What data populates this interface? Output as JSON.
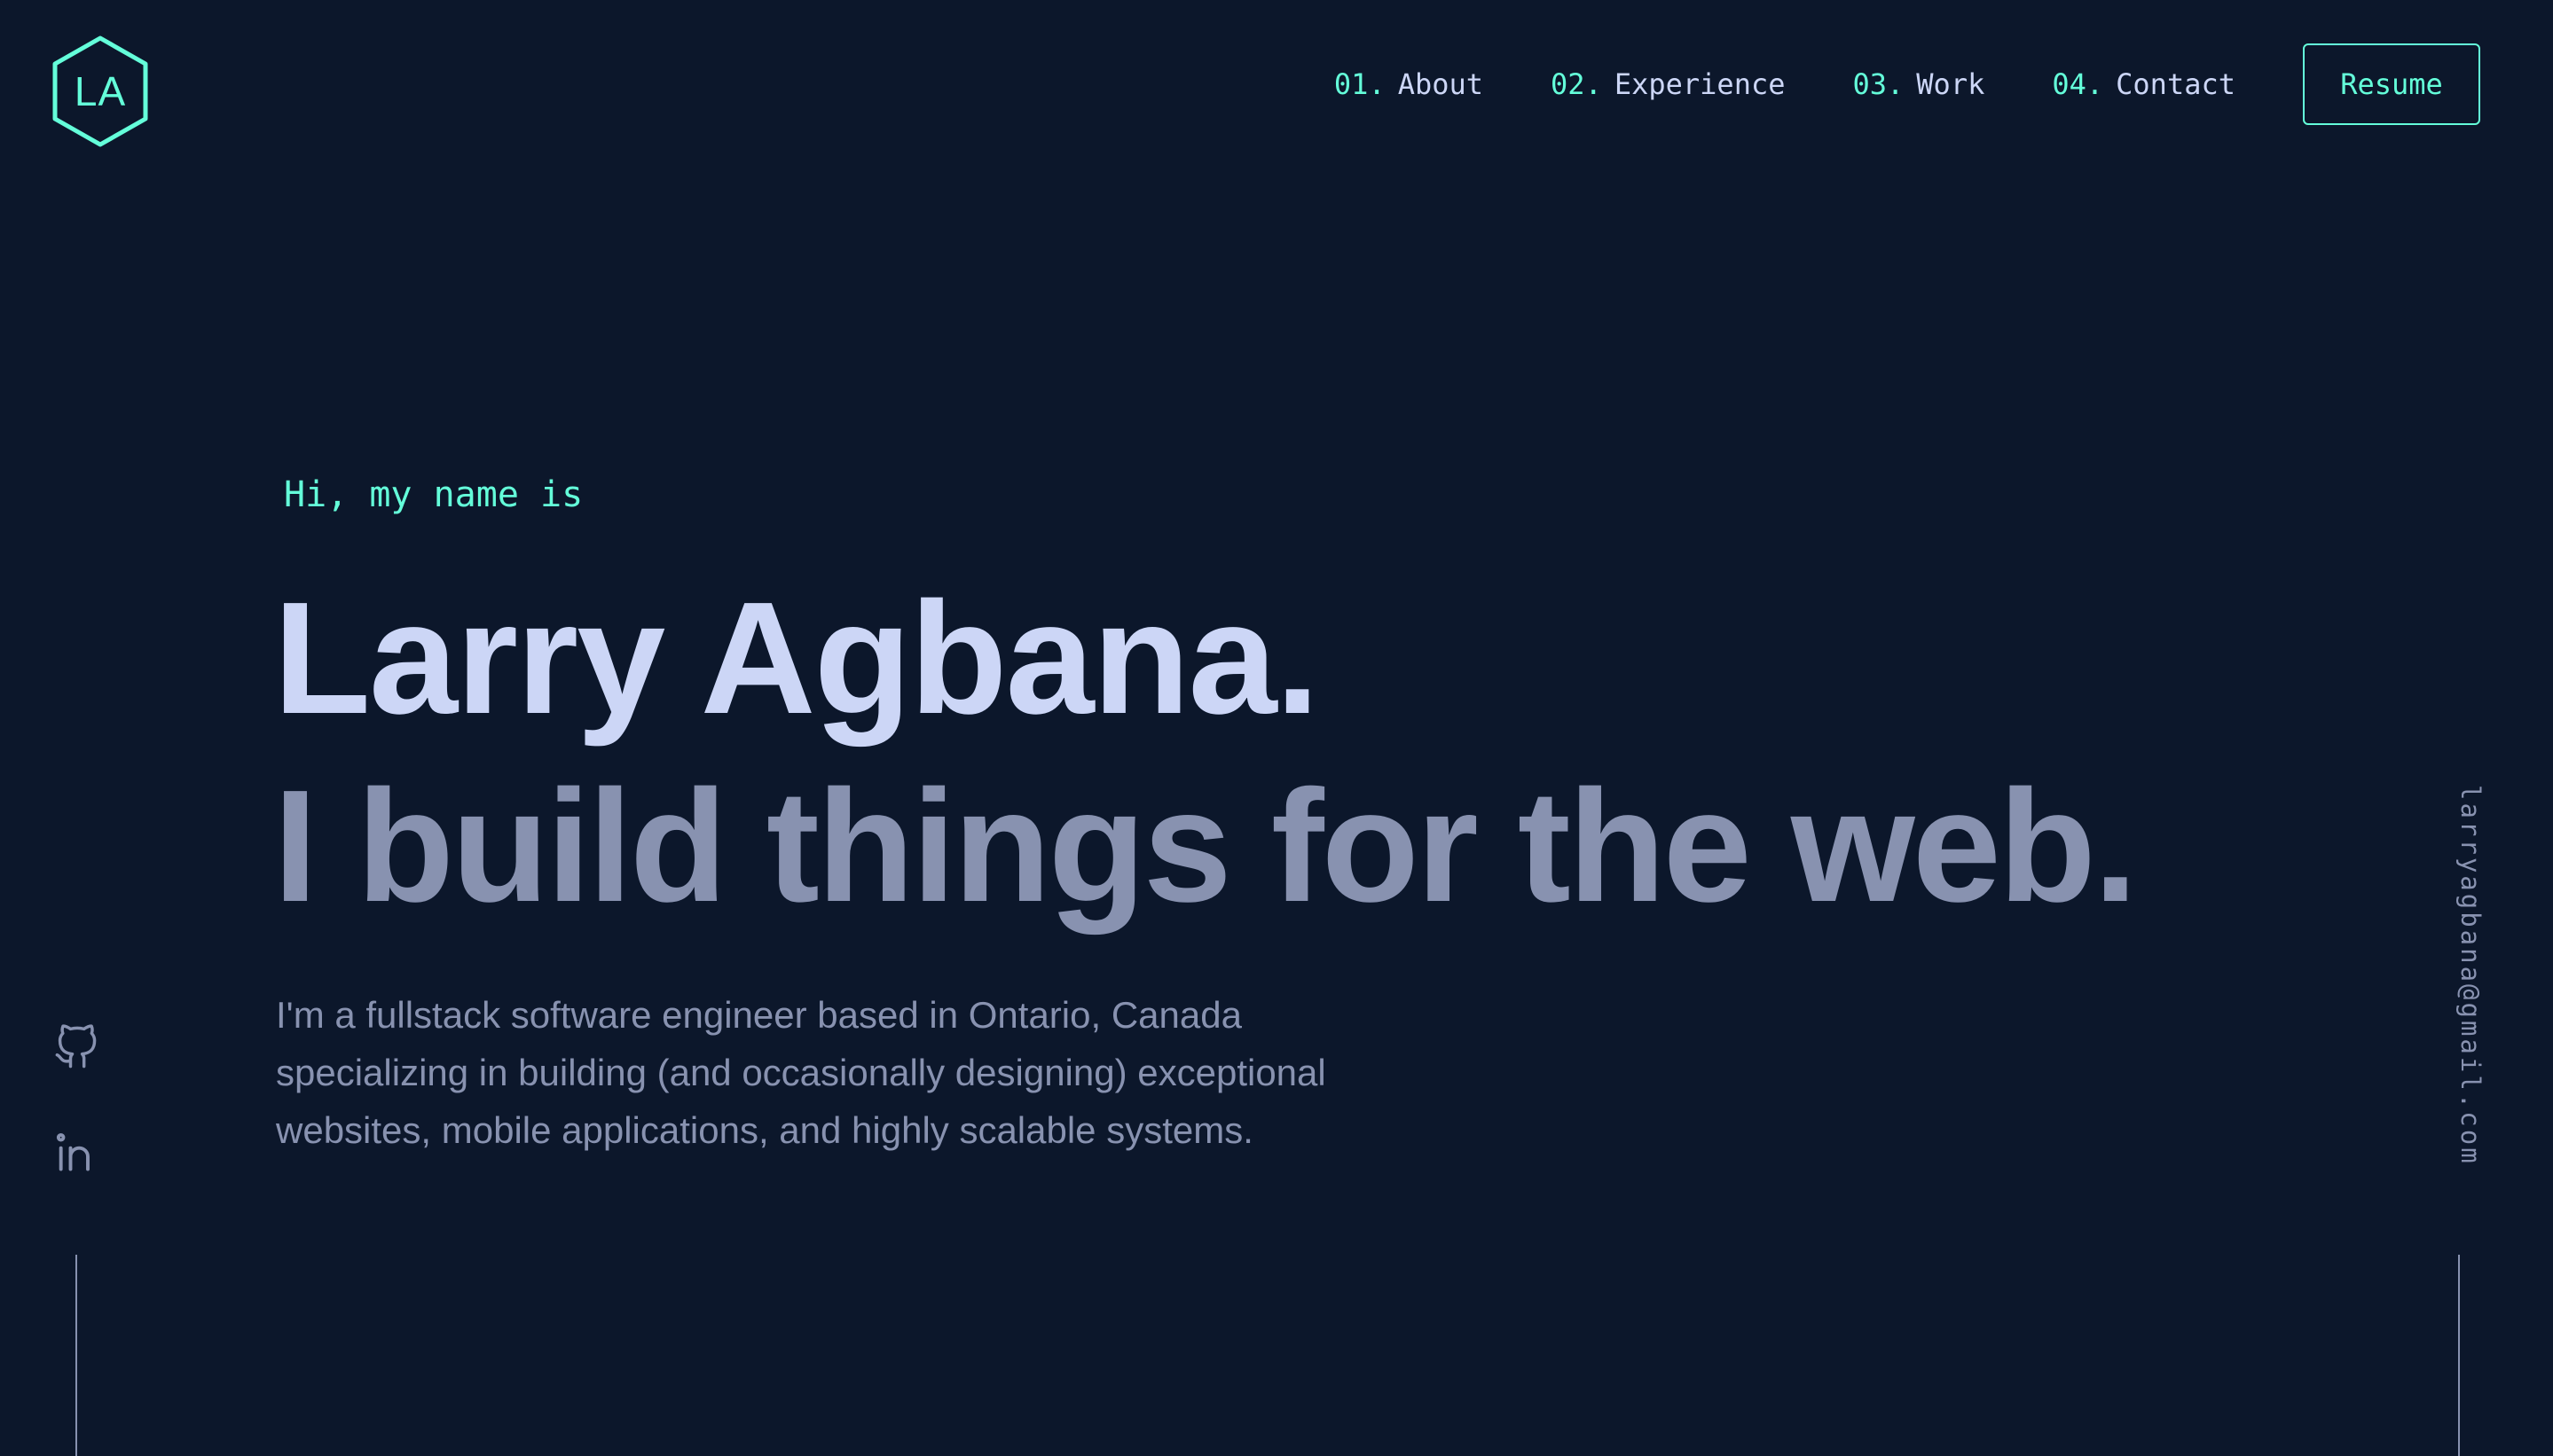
{
  "logo": {
    "text": "LA"
  },
  "nav": {
    "items": [
      {
        "num": "01.",
        "label": "About"
      },
      {
        "num": "02.",
        "label": "Experience"
      },
      {
        "num": "03.",
        "label": "Work"
      },
      {
        "num": "04.",
        "label": "Contact"
      }
    ],
    "resume_label": "Resume"
  },
  "hero": {
    "greeting": "Hi, my name is",
    "name": "Larry Agbana.",
    "tagline": "I build things for the web.",
    "bio_lines": [
      "I'm a fullstack software engineer based in Ontario, Canada",
      "specializing in building (and occasionally designing) exceptional",
      "websites, mobile applications, and highly scalable systems."
    ]
  },
  "social": {
    "icons": [
      "github-icon",
      "linkedin-icon"
    ]
  },
  "email": "larryagbana@gmail.com",
  "colors": {
    "background": "#0c172b",
    "accent": "#64ffda",
    "heading": "#ccd6f6",
    "muted": "#8892b0"
  }
}
